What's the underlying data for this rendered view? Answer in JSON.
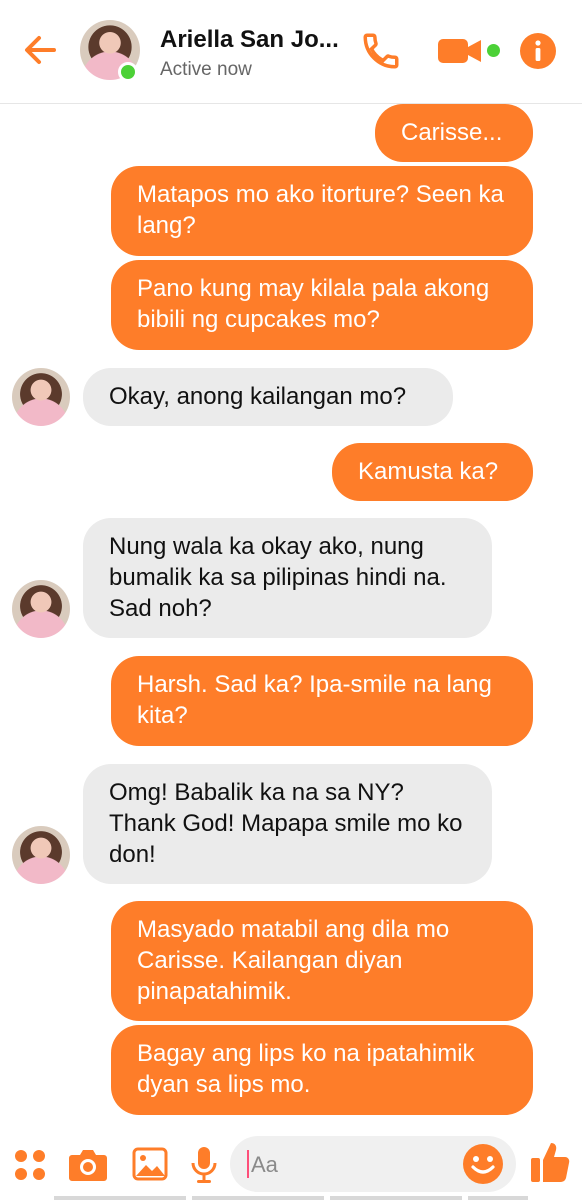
{
  "header": {
    "contact_name": "Ariella San Jo...",
    "status": "Active now",
    "accent": "#fe7d29",
    "online_color": "#4cd137",
    "icons": [
      "back-arrow-icon",
      "phone-icon",
      "video-camera-icon",
      "info-icon"
    ]
  },
  "messages": [
    {
      "from": "me",
      "text": "Carisse..."
    },
    {
      "from": "me",
      "text": "Matapos mo ako itorture? Seen ka lang?"
    },
    {
      "from": "me",
      "text": "Pano kung may kilala pala akong bibili ng cupcakes mo?"
    },
    {
      "from": "them",
      "text": "Okay, anong kailangan mo?"
    },
    {
      "from": "me",
      "text": "Kamusta ka?"
    },
    {
      "from": "them",
      "text": "Nung wala ka okay ako, nung bumalik ka sa pilipinas hindi na. Sad noh?"
    },
    {
      "from": "me",
      "text": "Harsh. Sad ka? Ipa-smile na lang kita?"
    },
    {
      "from": "them",
      "text": "Omg! Babalik ka na sa NY? Thank God! Mapapa smile mo ko don!"
    },
    {
      "from": "me",
      "text": "Masyado matabil ang dila mo Carisse. Kailangan diyan pinapatahimik."
    },
    {
      "from": "me",
      "text": "Bagay ang lips ko na ipatahimik dyan sa lips mo."
    }
  ],
  "composer": {
    "placeholder": "Aa",
    "icons": [
      "apps-grid-icon",
      "camera-icon",
      "image-icon",
      "microphone-icon",
      "emoji-icon",
      "thumbs-up-icon"
    ]
  }
}
